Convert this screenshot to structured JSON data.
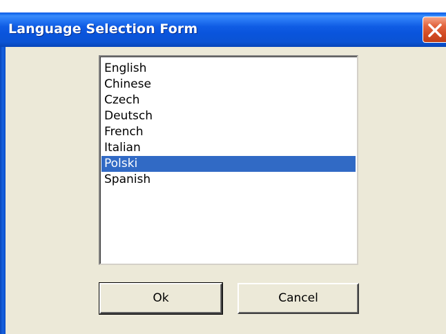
{
  "window": {
    "title": "Language Selection Form",
    "close_icon": "close-icon"
  },
  "languages": {
    "items": [
      "English",
      "Chinese",
      "Czech",
      "Deutsch",
      "French",
      "Italian",
      "Polski",
      "Spanish"
    ],
    "selected": "Polski"
  },
  "buttons": {
    "ok_label": "Ok",
    "cancel_label": "Cancel"
  },
  "colors": {
    "titlebar": "#0A54DC",
    "selection": "#316AC5",
    "dialog_bg": "#ECE9D8",
    "close_button": "#D24A22"
  }
}
